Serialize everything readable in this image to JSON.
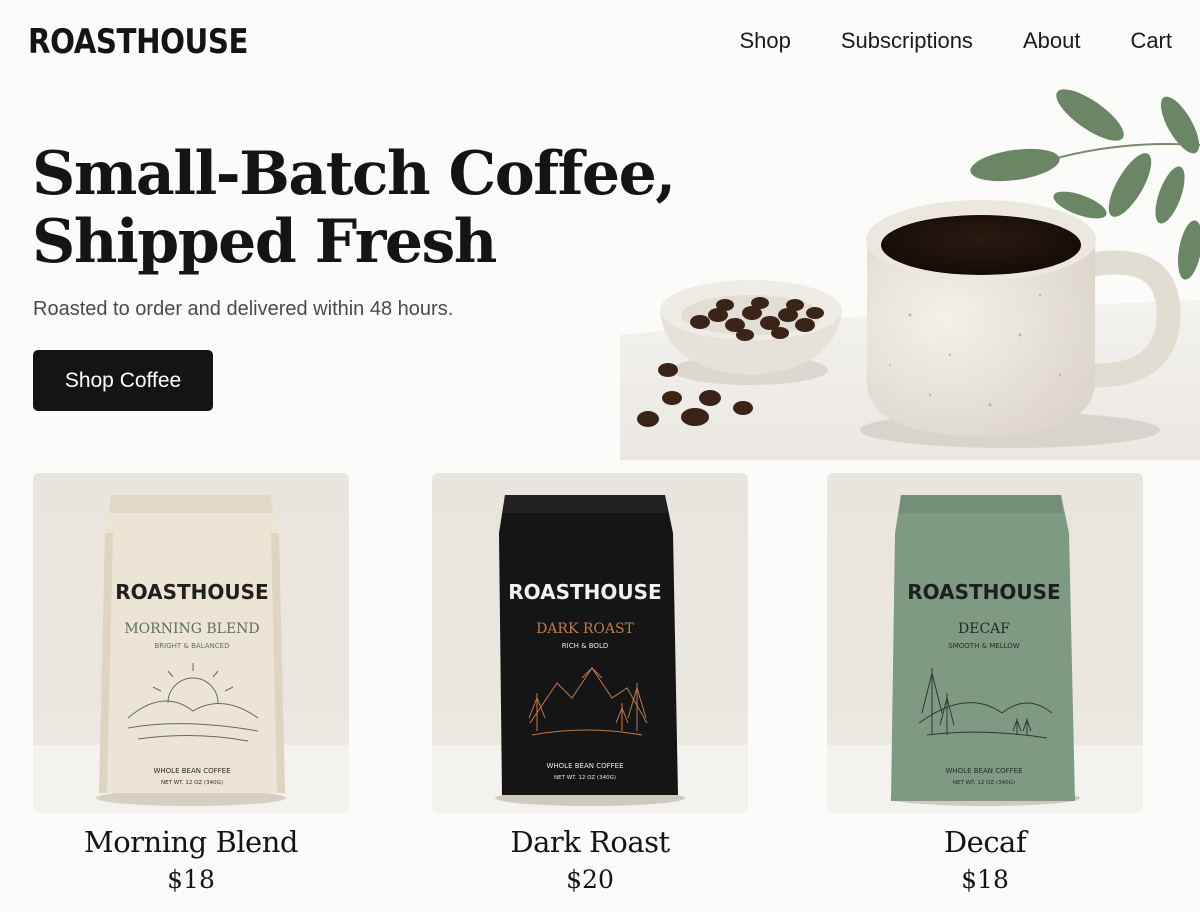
{
  "header": {
    "logo": "ROASTHOUSE",
    "nav": [
      "Shop",
      "Subscriptions",
      "About",
      "Cart"
    ]
  },
  "hero": {
    "title_line1": "Small-Batch Coffee,",
    "title_line2": "Shipped Fresh",
    "subtitle": "Roasted to order and delivered within 48 hours.",
    "cta_label": "Shop Coffee"
  },
  "products": [
    {
      "name": "Morning Blend",
      "price": "$18",
      "bag_brand": "ROASTHOUSE",
      "bag_title": "MORNING BLEND",
      "bag_tagline": "BRIGHT & BALANCED",
      "bag_footer1": "WHOLE BEAN COFFEE",
      "bag_footer2": "NET WT. 12 OZ (340G)",
      "bag_color": "#ece5d6",
      "accent_color": "#5b6e66"
    },
    {
      "name": "Dark Roast",
      "price": "$20",
      "bag_brand": "ROASTHOUSE",
      "bag_title": "DARK ROAST",
      "bag_tagline": "RICH & BOLD",
      "bag_footer1": "WHOLE BEAN COFFEE",
      "bag_footer2": "NET WT. 12 OZ (340G)",
      "bag_color": "#151515",
      "accent_color": "#c07a4e"
    },
    {
      "name": "Decaf",
      "price": "$18",
      "bag_brand": "ROASTHOUSE",
      "bag_title": "DECAF",
      "bag_tagline": "SMOOTH & MELLOW",
      "bag_footer1": "WHOLE BEAN COFFEE",
      "bag_footer2": "NET WT. 12 OZ (340G)",
      "bag_color": "#7e9a83",
      "accent_color": "#2d3a32"
    }
  ]
}
